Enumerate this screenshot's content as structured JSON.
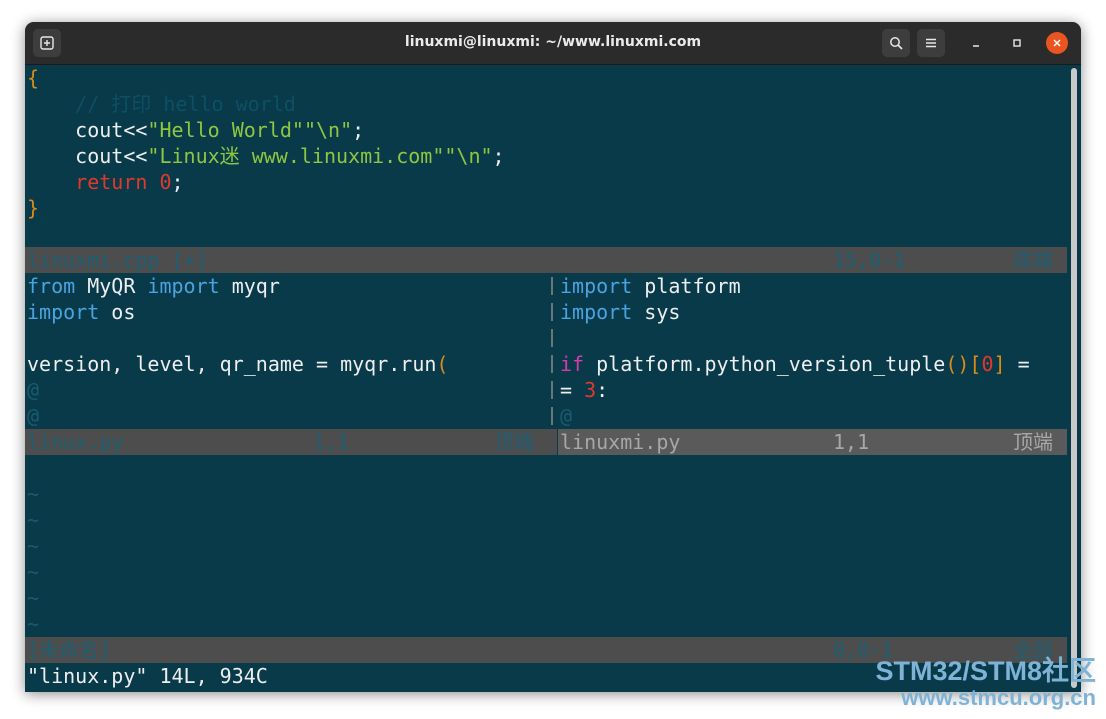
{
  "window": {
    "title": "linuxmi@linuxmi: ~/www.linuxmi.com",
    "icons": [
      "new-tab-icon",
      "search-icon",
      "hamburger-menu-icon",
      "minimize-icon",
      "maximize-icon",
      "close-icon"
    ]
  },
  "top_pane": {
    "lines": [
      {
        "brace": "{"
      },
      {
        "indent": "    ",
        "comment": "// 打印 hello world"
      },
      {
        "indent": "    ",
        "code": "cout<<",
        "str": "\"Hello World\"",
        "str2": "\"\\n\"",
        "end": ";"
      },
      {
        "indent": "    ",
        "code": "cout<<",
        "str": "\"Linux迷 www.linuxmi.com\"",
        "str2": "\"\\n\"",
        "end": ";"
      },
      {
        "indent": "    ",
        "keyword": "return",
        "num": "0",
        "end": ";"
      },
      {
        "brace": "}"
      }
    ],
    "status": {
      "file": "linuxmi.cpp [+]",
      "pos": "15,0-1",
      "scroll": "底端"
    }
  },
  "left_pane": {
    "lines": [
      {
        "k1": "from",
        "t1": " MyQR ",
        "k2": "import",
        "t2": " myqr"
      },
      {
        "k1": "import",
        "t1": " os"
      },
      {},
      {
        "t1": "version, level, qr_name = myqr.run",
        "paren": "("
      },
      {
        "at": "@"
      },
      {
        "at": "@"
      }
    ],
    "status": {
      "file": "linux.py",
      "pos": "1,1",
      "scroll": "顶端"
    }
  },
  "right_pane": {
    "lines": [
      {
        "k1": "import",
        "t1": " platform"
      },
      {
        "k1": "import",
        "t1": " sys"
      },
      {},
      {
        "k1": "if",
        "t1": " platform.python_version_tuple",
        "p1": "()[",
        "n1": "0",
        "p2": "]",
        "t2": " ="
      },
      {
        "t1": "= ",
        "n1": "3",
        "t2": ":"
      },
      {
        "at": "@"
      }
    ],
    "status": {
      "file": "linuxmi.py",
      "pos": "1,1",
      "scroll": "顶端"
    }
  },
  "bottom_pane": {
    "tildes": [
      "~",
      "~",
      "~",
      "~",
      "~",
      "~"
    ],
    "status": {
      "file": "[未命名]",
      "pos": "0,0-1",
      "scroll": "全部"
    }
  },
  "message": "\"linux.py\" 14L, 934C",
  "watermark": {
    "line1": "STM32/STM8社区",
    "line2": "www.stmcu.org.cn"
  },
  "colors": {
    "terminal_bg": "#083a4a",
    "keyword_blue": "#4aa3e0",
    "keyword_red": "#e0392b",
    "keyword_pink": "#d63ba8",
    "string_green": "#8ec641",
    "brace_orange": "#d88b1a"
  }
}
